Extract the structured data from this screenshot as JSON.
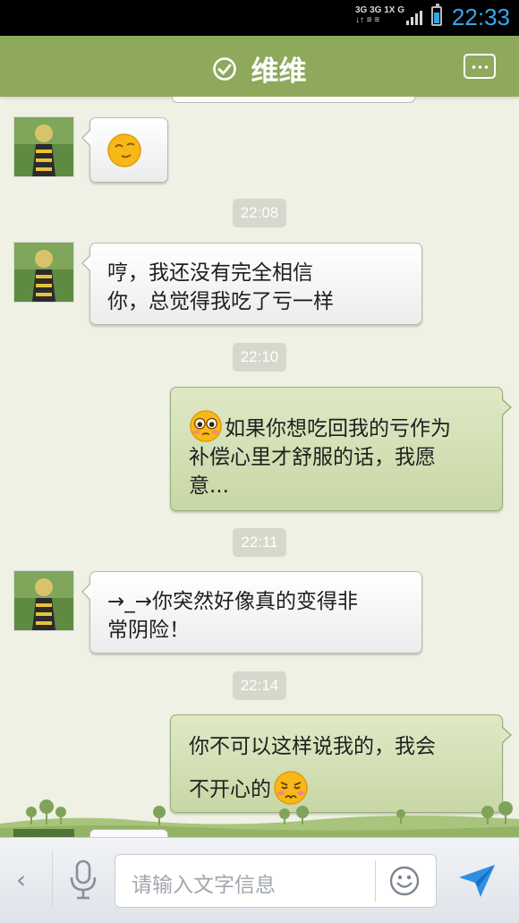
{
  "status_bar": {
    "network_line1": "3G 3G 1X G",
    "network_line2": "↓↑ ≡ ≡",
    "time": "22:33",
    "accent": "#38a7ef"
  },
  "header": {
    "title": "维维",
    "status_icon": "check-circle-icon",
    "menu_icon": "more-dots-icon",
    "bg_color": "#8ea95c"
  },
  "messages": [
    {
      "type": "received",
      "sticker": "smug-emoji"
    },
    {
      "type": "timestamp",
      "text": "22:08"
    },
    {
      "type": "received",
      "line1": "哼，我还没有完全相信",
      "line2": "你，总觉得我吃了亏一样"
    },
    {
      "type": "timestamp",
      "text": "22:10"
    },
    {
      "type": "sent",
      "emoji": "pleading-emoji",
      "line1": "如果你想吃回我的亏作为",
      "line2": "补偿心里才舒服的话，我愿",
      "line3": "意..."
    },
    {
      "type": "timestamp",
      "text": "22:11"
    },
    {
      "type": "received",
      "line1": "→_→你突然好像真的变得非",
      "line2": "常阴险！"
    },
    {
      "type": "timestamp",
      "text": "22:14"
    },
    {
      "type": "sent",
      "line1": "你不可以这样说我的，我会",
      "line2": "不开心的",
      "emoji": "upset-emoji"
    }
  ],
  "input_bar": {
    "placeholder": "请输入文字信息",
    "back_icon": "chevron-left-icon",
    "voice_icon": "microphone-icon",
    "emoji_icon": "smiley-icon",
    "send_icon": "send-icon"
  }
}
